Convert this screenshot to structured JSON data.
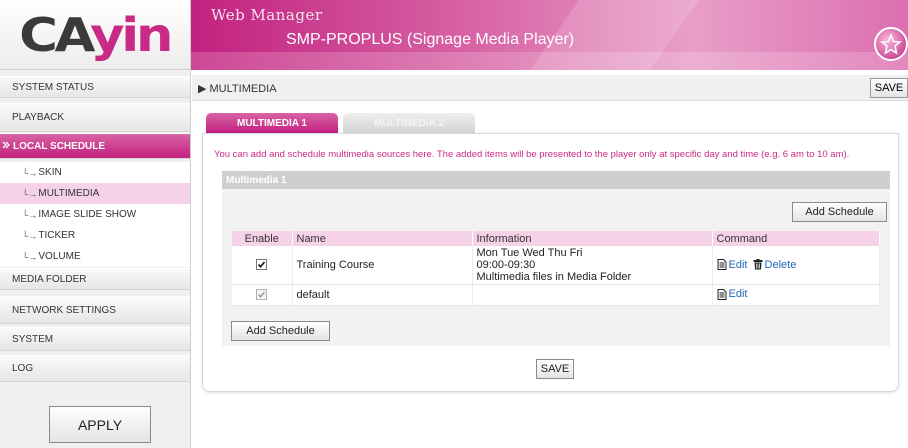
{
  "logo": {
    "text_a": "CA",
    "text_b": "yin"
  },
  "header": {
    "title": "Web Manager",
    "subtitle": "SMP-PROPLUS (Signage Media Player)"
  },
  "sidebar": {
    "items": [
      {
        "label": "SYSTEM STATUS"
      },
      {
        "label": "PLAYBACK"
      },
      {
        "label": "LOCAL SCHEDULE",
        "active": true
      },
      {
        "label": "MEDIA FOLDER"
      },
      {
        "label": "NETWORK SETTINGS"
      },
      {
        "label": "SYSTEM"
      },
      {
        "label": "LOG"
      }
    ],
    "subitems": [
      {
        "label": "SKIN"
      },
      {
        "label": "MULTIMEDIA",
        "active": true
      },
      {
        "label": "IMAGE SLIDE SHOW"
      },
      {
        "label": "TICKER"
      },
      {
        "label": "VOLUME"
      }
    ],
    "apply_label": "APPLY"
  },
  "main": {
    "breadcrumb": "MULTIMEDIA",
    "save_label": "SAVE",
    "tabs": [
      {
        "label": "MULTIMEDIA 1",
        "active": true
      },
      {
        "label": "MULTIMEDIA 2",
        "active": false
      }
    ],
    "intro": "You can add and schedule multimedia sources here. The added items will be presented to the player only at specific day and time (e.g. 6 am to 10 am).",
    "section_title": "Multimedia 1",
    "add_schedule_label": "Add Schedule",
    "table": {
      "columns": [
        "Enable",
        "Name",
        "Information",
        "Command"
      ],
      "rows": [
        {
          "enabled": true,
          "name": "Training Course",
          "info": [
            "Mon Tue Wed Thu Fri",
            "09:00-09:30",
            "Multimedia files in Media Folder"
          ],
          "edit": "Edit",
          "delete": "Delete"
        },
        {
          "enabled": true,
          "name": "default",
          "info": [],
          "edit": "Edit"
        }
      ]
    },
    "bottom_save_label": "SAVE"
  },
  "colors": {
    "accent": "#c2217f",
    "accent_light": "#f6d2e8",
    "link": "#2266bb"
  },
  "icons": [
    "document-icon",
    "trash-icon",
    "checkbox-checked-icon",
    "arrow-right-icon",
    "badge-star-icon"
  ]
}
